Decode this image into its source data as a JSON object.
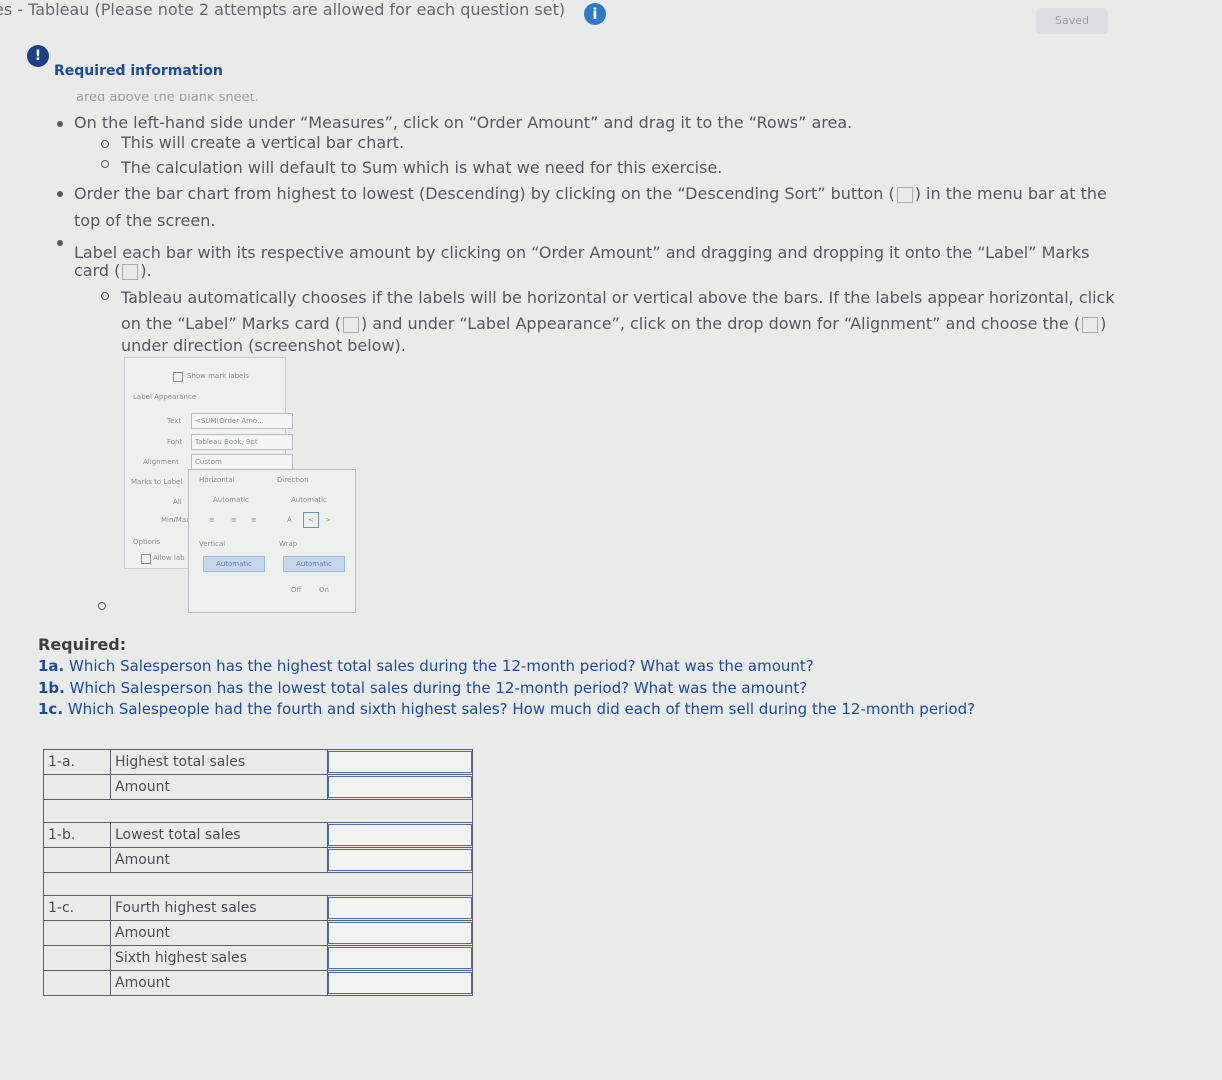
{
  "header": {
    "title": "es - Tableau (Please note 2 attempts are allowed for each question set)",
    "info_icon": "info-icon",
    "saved_label": "Saved"
  },
  "alert": {
    "icon": "alert-icon",
    "label": "Required information"
  },
  "instructions": {
    "cut_line": "ared above the blank sheet.",
    "b1": "On the left-hand side under “Measures”, click on “Order Amount” and drag it to the “Rows” area.",
    "b1_s1": "This will create a vertical bar chart.",
    "b1_s2": "The calculation will default to Sum which is what we need for this exercise.",
    "b2_l1a": "Order the bar chart from highest to lowest (Descending) by clicking on the “Descending Sort” button (",
    "b2_l1b": ") in the menu bar at the",
    "b2_l2": "top of the screen.",
    "b3_l1": "Label each bar with its respective amount by clicking on “Order Amount” and dragging and dropping it onto the “Label” Marks",
    "b3_l2a": "card (",
    "b3_l2b": ").",
    "s_l1": "Tableau automatically chooses if the labels will be horizontal or vertical above the bars. If the labels appear horizontal, click",
    "s_l2a": "on the “Label” Marks card (",
    "s_l2b": ") and under “Label Appearance”, click on the drop down for “Alignment” and choose the (",
    "s_l2c": ")",
    "s_l3": "under direction (screenshot below)."
  },
  "screenshot": {
    "show_marks": "Show mark labels",
    "label_appearance": "Label Appearance",
    "text_label": "Text",
    "text_value": "<SUM(Order Amo...",
    "font_label": "Font",
    "font_value": "Tableau Book, 9pt",
    "alignment_label": "Alignment",
    "alignment_value": "Custom",
    "marks_to_label": "Marks to Label",
    "all": "All",
    "min_max": "Min/Max",
    "options": "Options",
    "allow_label": "Allow lab",
    "horizontal": "Horizontal",
    "direction": "Direction",
    "automatic": "Automatic",
    "vertical": "Vertical",
    "wrap": "Wrap",
    "off": "Off",
    "on": "On"
  },
  "required": {
    "heading": "Required:",
    "q1a_num": "1a.",
    "q1a": "Which Salesperson has the highest total sales during the 12-month period? What was the amount?",
    "q1b_num": "1b.",
    "q1b": "Which Salesperson has the lowest total sales during the 12-month period? What was the amount?",
    "q1c_num": "1c.",
    "q1c": "Which Salespeople had the fourth and sixth highest sales? How much did each of them sell during the 12-month period?"
  },
  "answer_table": {
    "r1_num": "1-a.",
    "r1_label": "Highest total sales",
    "r2_label": "Amount",
    "r3_num": "1-b.",
    "r3_label": "Lowest total sales",
    "r4_label": "Amount",
    "r5_num": "1-c.",
    "r5_label": "Fourth highest sales",
    "r6_label": "Amount",
    "r7_label": "Sixth highest sales",
    "r8_label": "Amount"
  }
}
